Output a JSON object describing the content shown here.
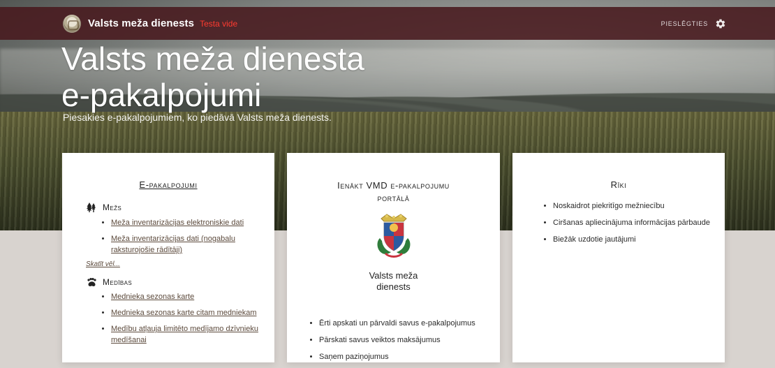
{
  "nav": {
    "brand_name": "Valsts meža dienests",
    "env_label": "Testa vide",
    "login_label": "PIESLĒGTIES",
    "settings_icon": "gear-icon"
  },
  "hero": {
    "title_line1": "Valsts meža dienesta",
    "title_line2": "e-pakalpojumi",
    "subtitle": "Piesakies e-pakalpojumiem, ko piedāvā Valsts meža dienests."
  },
  "cards": {
    "services": {
      "title": "E-pakalpojumi",
      "sections": {
        "mezs": {
          "label": "Mežs",
          "icon": "trees-icon",
          "items": [
            "Meža inventarizācijas elektroniskie dati",
            "Meža inventarizācijas dati (nogabalu raksturojošie rādītāji)"
          ],
          "more_label": "Skatīt vēl..."
        },
        "medibas": {
          "label": "Medības",
          "icon": "paw-icon",
          "items": [
            "Mednieka sezonas karte",
            "Mednieka sezonas karte citam medniekam",
            "Medību atļauja limitēto medījamo dzīvnieku medīšanai"
          ]
        }
      }
    },
    "portal": {
      "title": "Ienākt VMD e-pakalpojumu portālā",
      "org_name_line1": "Valsts meža",
      "org_name_line2": "dienests",
      "bullets": [
        "Ērti apskati un pārvaldi savus e-pakalpojumus",
        "Pārskati savus veiktos maksājumus",
        "Saņem paziņojumus"
      ]
    },
    "tools": {
      "title": "Rīki",
      "items": [
        "Noskaidrot piekritīgo mežniecību",
        "Ciršanas apliecinājuma informācijas pārbaude",
        "Biežāk uzdotie jautājumi"
      ]
    }
  }
}
